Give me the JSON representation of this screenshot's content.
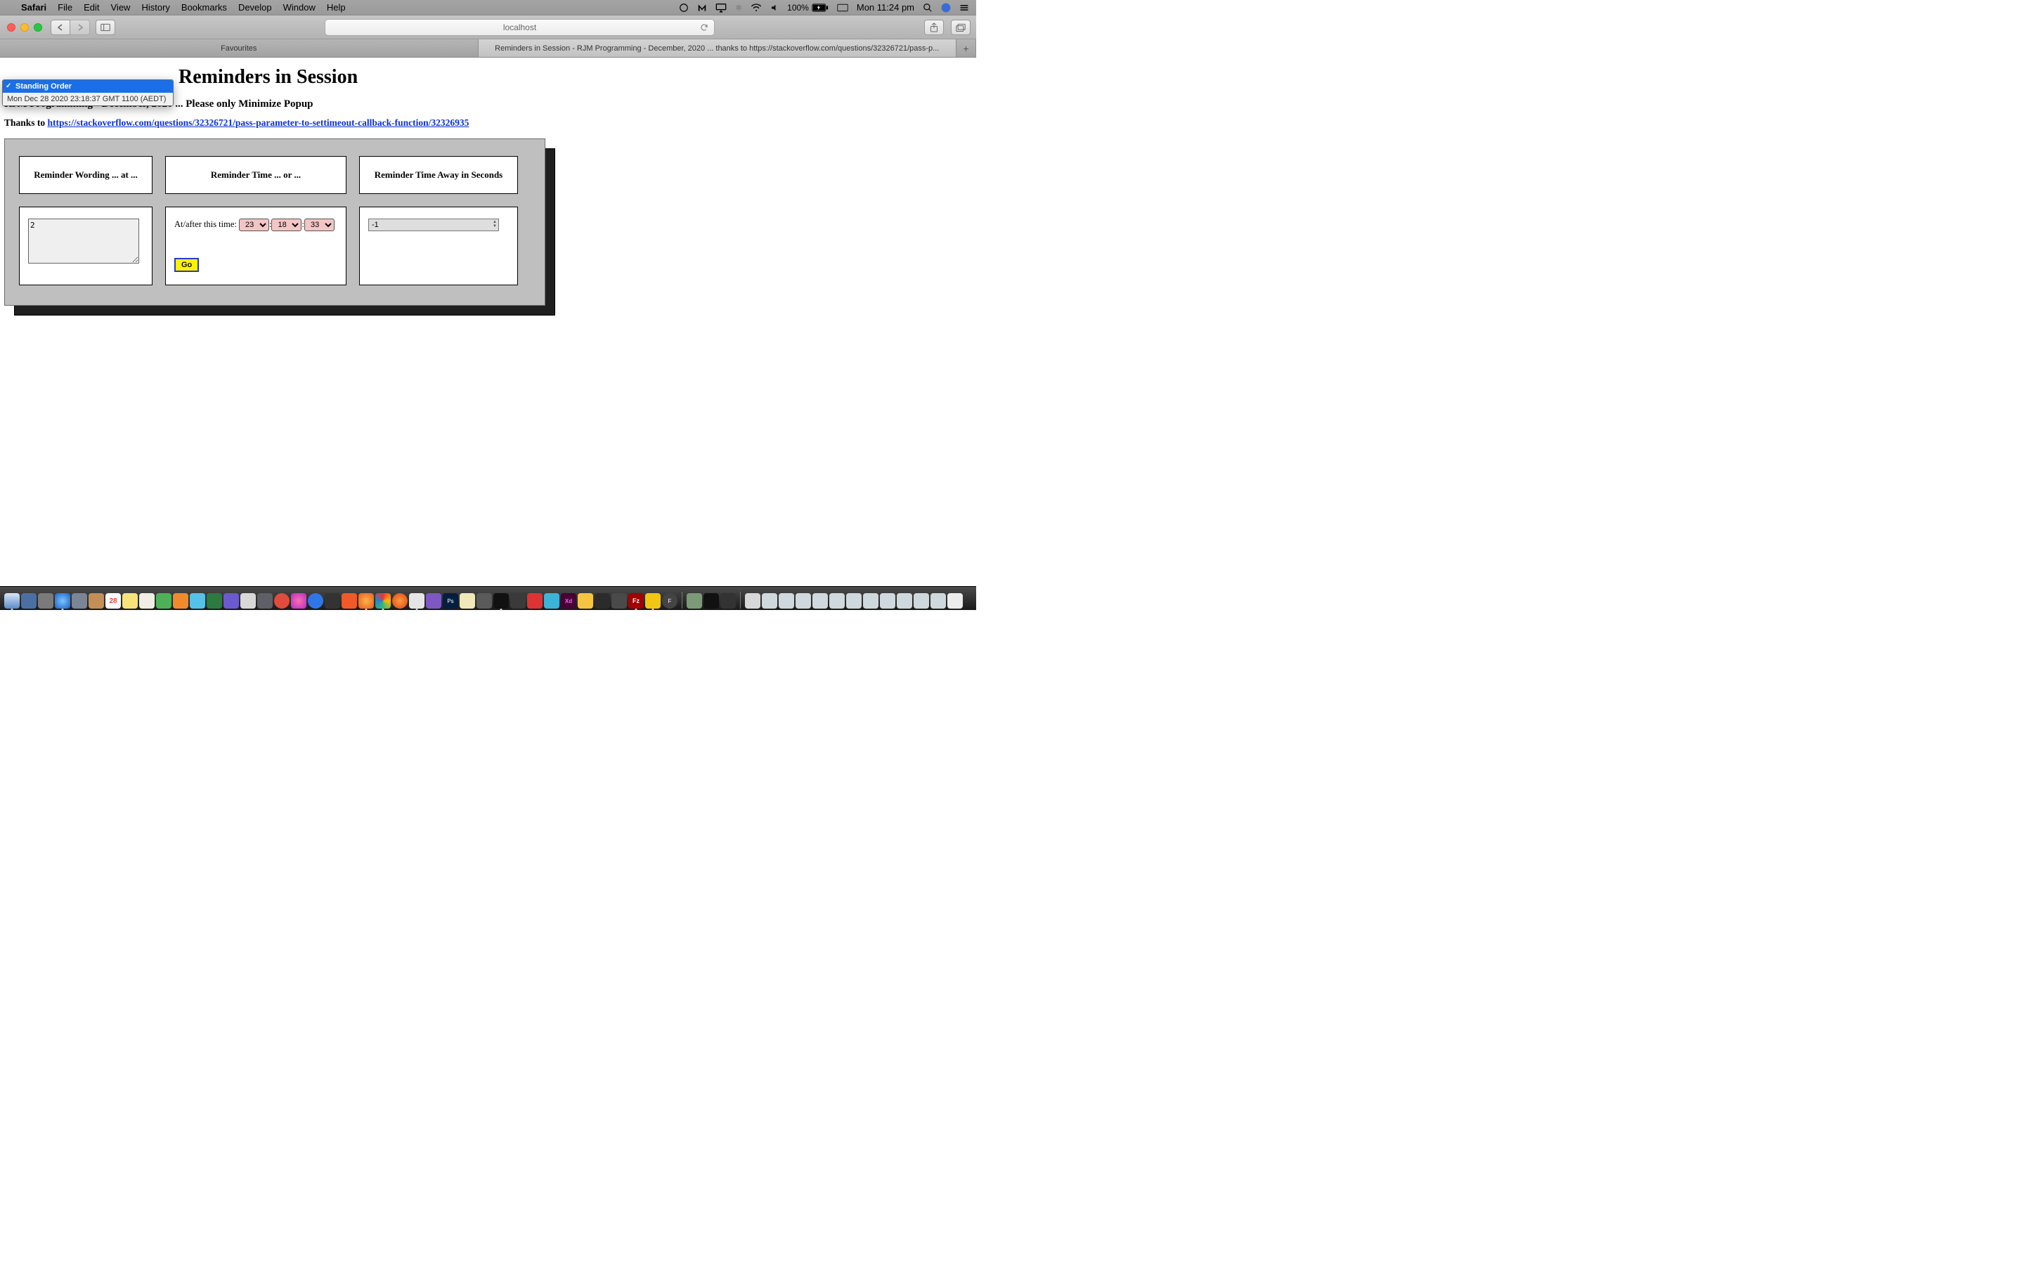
{
  "menubar": {
    "app": "Safari",
    "items": [
      "File",
      "Edit",
      "View",
      "History",
      "Bookmarks",
      "Develop",
      "Window",
      "Help"
    ],
    "battery": "100%",
    "clock": "Mon 11:24 pm"
  },
  "toolbar": {
    "url": "localhost"
  },
  "tabs": {
    "fav": "Favourites",
    "active": "Reminders in Session - RJM Programming - December, 2020 ... thanks to https://stackoverflow.com/questions/32326721/pass-p..."
  },
  "notif": {
    "title": "Standing Order",
    "body": "Mon Dec 28 2020 23:18:37 GMT 1100 (AEDT)"
  },
  "page": {
    "title": "Reminders in Session",
    "subtitle": "RJM Programming - December, 2020 ... Please only Minimize Popup",
    "thanks_prefix": "Thanks to ",
    "thanks_link": "https://stackoverflow.com/questions/32326721/pass-parameter-to-settimeout-callback-function/32326935"
  },
  "panel": {
    "headers": {
      "wording": "Reminder Wording ... at ...",
      "time": "Reminder Time ... or ...",
      "away": "Reminder Time Away in Seconds"
    },
    "wording_value": "2",
    "time_label": "At/after this time:",
    "time_hh": "23",
    "time_mm": "18",
    "time_ss": "33",
    "go": "Go",
    "away_value": "-1"
  },
  "dock": {
    "cal_day": "28"
  }
}
